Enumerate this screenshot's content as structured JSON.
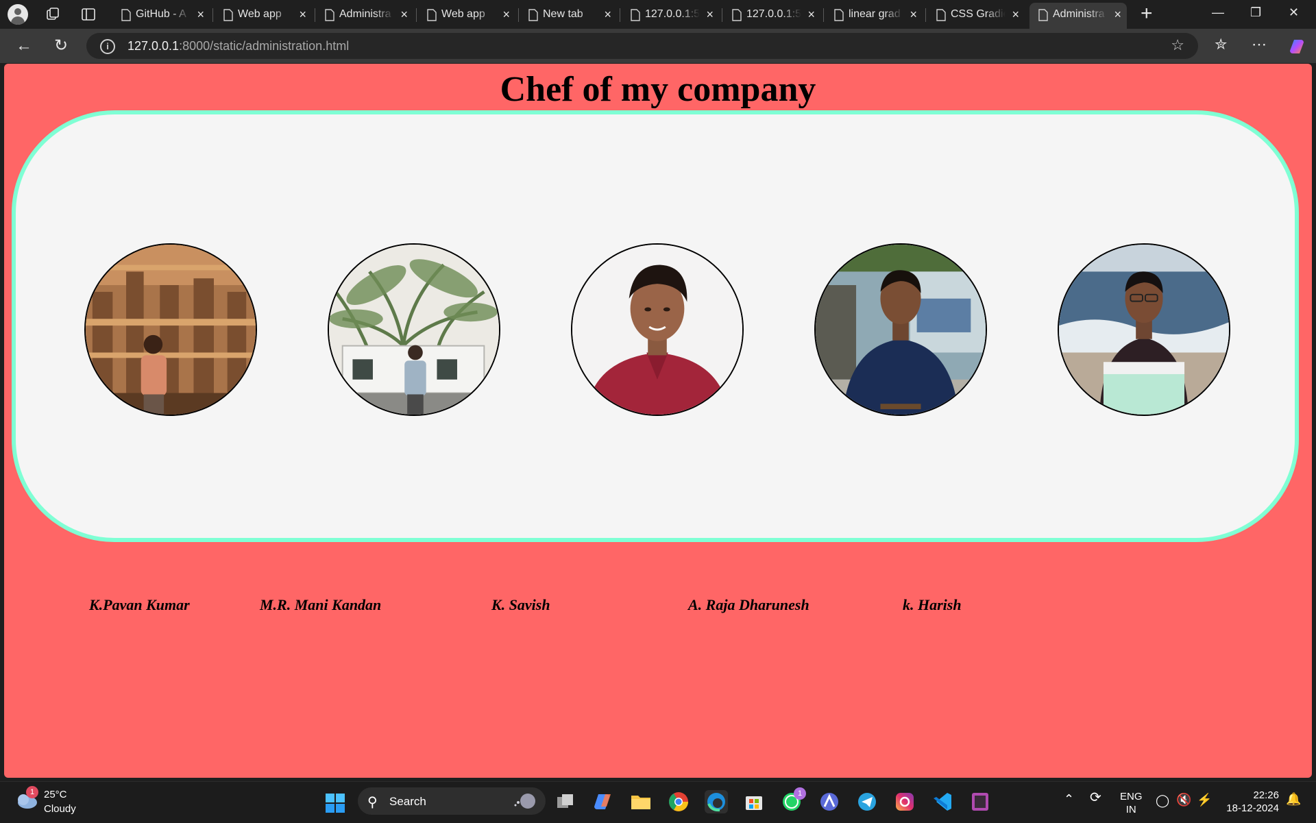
{
  "browser": {
    "tabs": [
      {
        "title": "GitHub - A",
        "icon": "github-icon",
        "active": false
      },
      {
        "title": "Web app",
        "icon": "page-icon",
        "active": false
      },
      {
        "title": "Administra",
        "icon": "page-icon",
        "active": false
      },
      {
        "title": "Web app",
        "icon": "page-icon",
        "active": false
      },
      {
        "title": "New tab",
        "icon": "new-tab-icon",
        "active": false
      },
      {
        "title": "127.0.0.1:5",
        "icon": "page-icon",
        "active": false
      },
      {
        "title": "127.0.0.1:5",
        "icon": "page-icon",
        "active": false
      },
      {
        "title": "linear grad",
        "icon": "search-icon",
        "active": false
      },
      {
        "title": "CSS Gradie",
        "icon": "edge-icon",
        "active": false
      },
      {
        "title": "Administra",
        "icon": "page-icon",
        "active": true
      }
    ],
    "close_glyph": "×",
    "new_tab_glyph": "+",
    "address": {
      "host": "127.0.0.1",
      "rest": ":8000/static/administration.html"
    }
  },
  "page": {
    "title": "Chef of my company",
    "chefs": [
      {
        "name": "K.Pavan Kumar",
        "photo": "temple-photo"
      },
      {
        "name": "M.R. Mani Kandan",
        "photo": "palm-tree-photo"
      },
      {
        "name": "K. Savish",
        "photo": "portrait-red-shirt-photo"
      },
      {
        "name": "A. Raja Dharunesh",
        "photo": "portrait-blue-shirt-photo"
      },
      {
        "name": "k. Harish",
        "photo": "beach-photo"
      }
    ],
    "colors": {
      "background": "#ff6666",
      "panel": "#f5f5f5",
      "panel_border": "#7fffd4"
    }
  },
  "taskbar": {
    "weather": {
      "temp": "25°C",
      "desc": "Cloudy",
      "badge": "1"
    },
    "search_label": "Search",
    "whatsapp_badge": "1",
    "lang_top": "ENG",
    "lang_bottom": "IN",
    "time": "22:26",
    "date": "18-12-2024"
  }
}
